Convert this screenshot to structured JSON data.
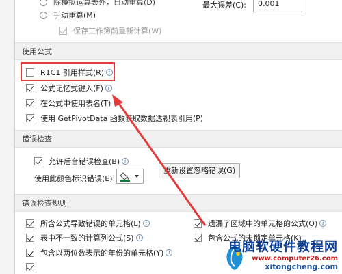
{
  "calc": {
    "partial_text": "除模拟运算表外，自动重算(D)",
    "manual": "手动重算(M)",
    "save_recalc": "保存工作簿前重新计算(W)",
    "max_change_label": "最大误差(C):",
    "max_change_value": "0.001"
  },
  "formulas": {
    "header": "使用公式",
    "r1c1": "R1C1 引用样式(R)",
    "autocomplete": "公式记忆式键入(F)",
    "table_names": "在公式中使用表名(T)",
    "getpivotdata": "使用 GetPivotData 函数获取数据透视表引用(P)"
  },
  "error_check": {
    "header": "错误检查",
    "enable_bg": "允许后台错误检查(B)",
    "color_label": "使用此颜色标识错误(E):",
    "reset_btn": "重新设置忽略错误(G)"
  },
  "rules": {
    "header": "错误检查规则",
    "items": [
      "所含公式导致错误的单元格(L)",
      "表中不一致的计算列公式(S)",
      "包含以两位数表示的年份的单元格(Y)",
      "遗漏了区域中的单元格的公式(O)",
      "包含公式的未锁定单元格(K)"
    ]
  },
  "watermark": {
    "title": "电脑软硬件教程网",
    "url": "www.computer26.com",
    "site": "xitongcheng.com"
  },
  "colors": {
    "arrow": "#e23b3b",
    "highlight": "#e23b3b"
  }
}
